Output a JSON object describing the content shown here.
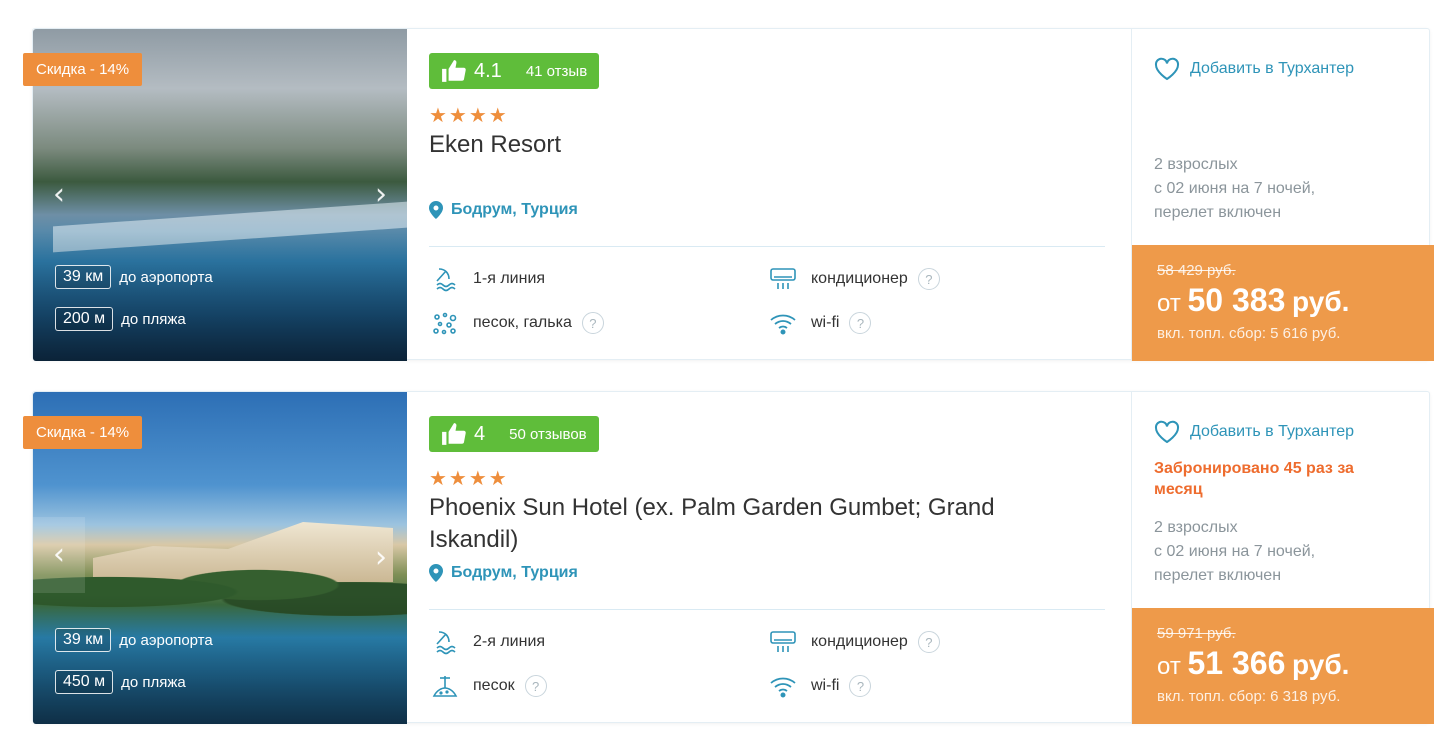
{
  "cards": [
    {
      "discount": "Скидка - 14%",
      "photo_distances": [
        {
          "value": "39 км",
          "label": "до аэропорта"
        },
        {
          "value": "200 м",
          "label": "до пляжа"
        }
      ],
      "rating": {
        "score": "4.1",
        "reviews": "41 отзыв"
      },
      "stars": 4,
      "name": "Eken Resort",
      "location": "Бодрум, Турция",
      "features": [
        {
          "icon": "beach-line-icon",
          "label": "1-я линия",
          "hint": false
        },
        {
          "icon": "sand-pebble-icon",
          "label": "песок, галька",
          "hint": true
        },
        {
          "icon": "air-conditioner-icon",
          "label": "кондиционер",
          "hint": true
        },
        {
          "icon": "wifi-icon",
          "label": "wi-fi",
          "hint": true
        }
      ],
      "favorite_label": "Добавить в Турхантер",
      "booked_note": "",
      "terms": [
        "2 взрослых",
        "с 02 июня на 7 ночей,",
        "перелет включен"
      ],
      "price": {
        "old": "58 429 руб.",
        "prefix": "от",
        "amount": "50 383",
        "currency": "руб.",
        "tax": "вкл. топл. сбор: 5 616 руб."
      }
    },
    {
      "discount": "Скидка - 14%",
      "photo_distances": [
        {
          "value": "39 км",
          "label": "до аэропорта"
        },
        {
          "value": "450 м",
          "label": "до пляжа"
        }
      ],
      "rating": {
        "score": "4",
        "reviews": "50 отзывов"
      },
      "stars": 4,
      "name": "Phoenix Sun Hotel (ex. Palm Garden Gumbet; Grand Iskandil)",
      "location": "Бодрум, Турция",
      "features": [
        {
          "icon": "beach-line-icon",
          "label": "2-я линия",
          "hint": false
        },
        {
          "icon": "sand-icon",
          "label": "песок",
          "hint": true
        },
        {
          "icon": "air-conditioner-icon",
          "label": "кондиционер",
          "hint": true
        },
        {
          "icon": "wifi-icon",
          "label": "wi-fi",
          "hint": true
        }
      ],
      "favorite_label": "Добавить в Турхантер",
      "booked_note": "Забронировано 45 раз за месяц",
      "terms": [
        "2 взрослых",
        "с 02 июня на 7 ночей,",
        "перелет включен"
      ],
      "price": {
        "old": "59 971 руб.",
        "prefix": "от",
        "amount": "51 366",
        "currency": "руб.",
        "tax": "вкл. топл. сбор: 6 318 руб."
      }
    }
  ],
  "colors": {
    "accent_orange": "#ee9a4a",
    "rating_green": "#5fbd3a",
    "link_blue": "#2e94b8",
    "booked_red": "#ee6c2e"
  },
  "icons": {
    "hint": "?",
    "arrow_left": "‹",
    "arrow_right": "›"
  }
}
